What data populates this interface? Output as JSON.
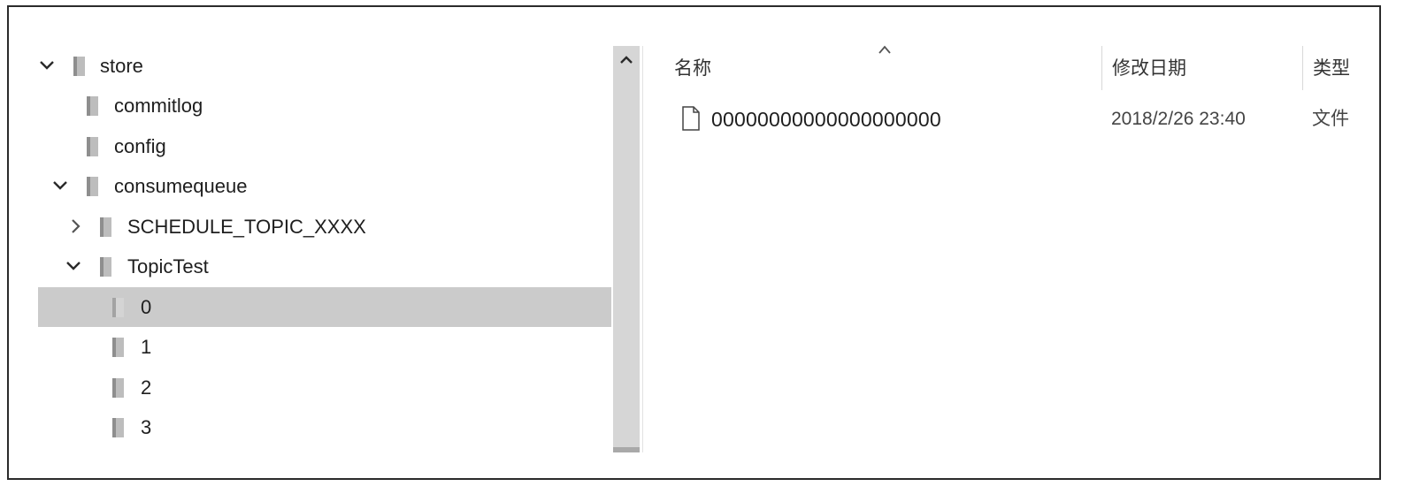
{
  "tree": {
    "items": [
      {
        "label": "store",
        "expander": "chevron-down",
        "icon": "folder-icon"
      },
      {
        "label": "commitlog",
        "expander": "none",
        "icon": "folder-icon"
      },
      {
        "label": "config",
        "expander": "none",
        "icon": "folder-icon"
      },
      {
        "label": "consumequeue",
        "expander": "chevron-down",
        "icon": "folder-icon"
      },
      {
        "label": "SCHEDULE_TOPIC_XXXX",
        "expander": "chevron-right",
        "icon": "folder-icon"
      },
      {
        "label": "TopicTest",
        "expander": "chevron-down",
        "icon": "folder-icon"
      },
      {
        "label": "0",
        "expander": "none",
        "icon": "folder-icon",
        "selected": true
      },
      {
        "label": "1",
        "expander": "none",
        "icon": "folder-icon"
      },
      {
        "label": "2",
        "expander": "none",
        "icon": "folder-icon"
      },
      {
        "label": "3",
        "expander": "none",
        "icon": "folder-icon"
      }
    ],
    "selected_color": "#cbcbcb"
  },
  "file_list": {
    "columns": {
      "name": "名称",
      "modified": "修改日期",
      "type": "类型"
    },
    "sort_indicator": "sort-ascending-icon",
    "rows": [
      {
        "name": "00000000000000000000",
        "modified": "2018/2/26 23:40",
        "type": "文件",
        "icon": "file-icon"
      }
    ]
  }
}
